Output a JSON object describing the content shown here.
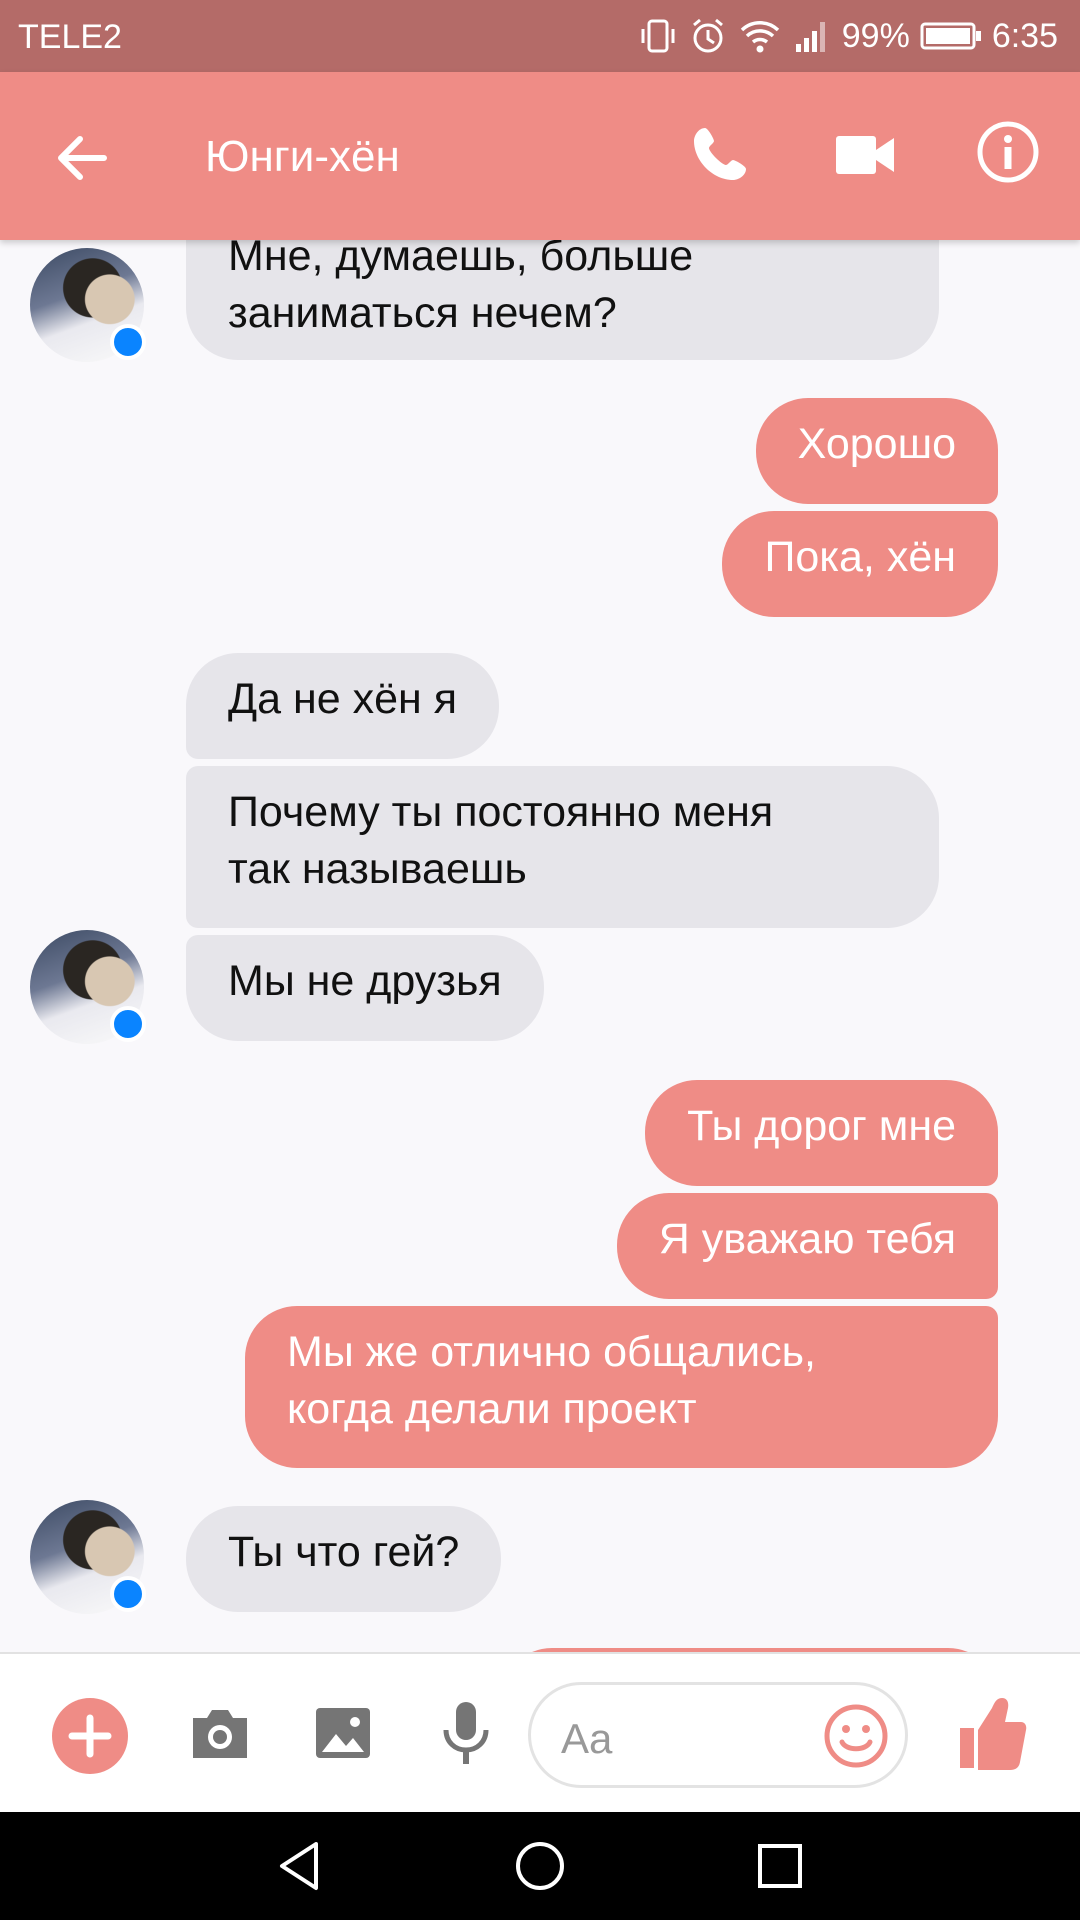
{
  "status_bar": {
    "carrier": "TELE2",
    "battery": "99%",
    "time": "6:35"
  },
  "header": {
    "title": "Юнги-хён"
  },
  "messages": [
    {
      "from": "them",
      "lines": [
        "Мне, думаешь, больше",
        "заниматься нечем?"
      ]
    },
    {
      "from": "me",
      "lines": [
        "Хорошо"
      ]
    },
    {
      "from": "me",
      "lines": [
        "Пока, хён"
      ]
    },
    {
      "from": "them",
      "lines": [
        "Да не хён я"
      ]
    },
    {
      "from": "them",
      "lines": [
        "Почему ты постоянно меня",
        "так называешь"
      ]
    },
    {
      "from": "them",
      "lines": [
        "Мы не друзья"
      ]
    },
    {
      "from": "me",
      "lines": [
        "Ты дорог мне"
      ]
    },
    {
      "from": "me",
      "lines": [
        "Я уважаю тебя"
      ]
    },
    {
      "from": "me",
      "lines": [
        "Мы же отлично общались,",
        "когда делали проект"
      ]
    },
    {
      "from": "them",
      "lines": [
        "Ты что гей?"
      ]
    }
  ],
  "composer": {
    "placeholder": "Aa"
  },
  "theme": {
    "accent": "#ef8c86",
    "status_bar": "#b46b68",
    "incoming_bubble": "#e6e5ea"
  },
  "icons": [
    "back-arrow-icon",
    "phone-icon",
    "video-camera-icon",
    "info-icon",
    "plus-icon",
    "camera-icon",
    "image-icon",
    "microphone-icon",
    "emoji-icon",
    "thumbs-up-icon",
    "nav-back-icon",
    "nav-home-icon",
    "nav-recents-icon"
  ]
}
